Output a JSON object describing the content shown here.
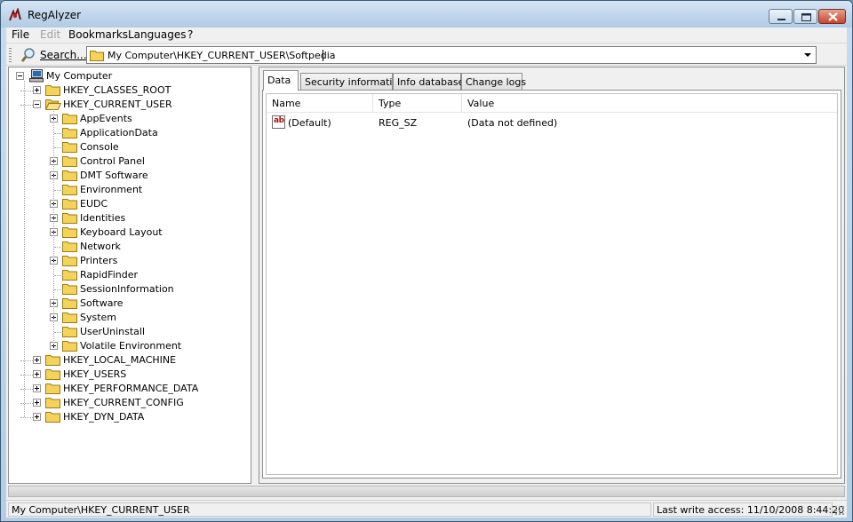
{
  "window": {
    "title": "RegAlyzer"
  },
  "menu": [
    "File",
    "Edit",
    "Bookmarks",
    "Languages",
    "?"
  ],
  "toolbar": {
    "search_label": "Search...",
    "address": "My Computer\\HKEY_CURRENT_USER\\Softpedia"
  },
  "tree": {
    "root": "My Computer",
    "hives": [
      {
        "label": "HKEY_CLASSES_ROOT",
        "expanded": false
      },
      {
        "label": "HKEY_CURRENT_USER",
        "expanded": true,
        "children": [
          {
            "label": "AppEvents",
            "has_children": true
          },
          {
            "label": "ApplicationData",
            "has_children": false
          },
          {
            "label": "Console",
            "has_children": false
          },
          {
            "label": "Control Panel",
            "has_children": true
          },
          {
            "label": "DMT Software",
            "has_children": true
          },
          {
            "label": "Environment",
            "has_children": false
          },
          {
            "label": "EUDC",
            "has_children": true
          },
          {
            "label": "Identities",
            "has_children": true
          },
          {
            "label": "Keyboard Layout",
            "has_children": true
          },
          {
            "label": "Network",
            "has_children": false
          },
          {
            "label": "Printers",
            "has_children": true
          },
          {
            "label": "RapidFinder",
            "has_children": false
          },
          {
            "label": "SessionInformation",
            "has_children": false
          },
          {
            "label": "Software",
            "has_children": true
          },
          {
            "label": "System",
            "has_children": true
          },
          {
            "label": "UserUninstall",
            "has_children": false
          },
          {
            "label": "Volatile Environment",
            "has_children": true
          }
        ]
      },
      {
        "label": "HKEY_LOCAL_MACHINE",
        "expanded": false
      },
      {
        "label": "HKEY_USERS",
        "expanded": false
      },
      {
        "label": "HKEY_PERFORMANCE_DATA",
        "expanded": false
      },
      {
        "label": "HKEY_CURRENT_CONFIG",
        "expanded": false
      },
      {
        "label": "HKEY_DYN_DATA",
        "expanded": false
      }
    ]
  },
  "tabs": [
    "Data",
    "Security information",
    "Info database",
    "Change logs"
  ],
  "active_tab": "Data",
  "values_table": {
    "columns": [
      "Name",
      "Type",
      "Value"
    ],
    "rows": [
      {
        "icon": "string-value-icon",
        "icon_text": "ab",
        "name": "(Default)",
        "type": "REG_SZ",
        "value": "(Data not defined)"
      }
    ]
  },
  "status": {
    "path": "My Computer\\HKEY_CURRENT_USER",
    "last_write": "Last write access: 11/10/2008 8:44:20"
  },
  "icons": {
    "app": "regalyzer-app-icon",
    "search": "magnifier-icon",
    "folder": "folder-icon",
    "computer": "computer-icon",
    "dropdown": "chevron-down-icon"
  },
  "colors": {
    "folder": "#f5d35a",
    "folder_outline": "#9b7b15",
    "title_gradient_top": "#d7e6f4",
    "close_button": "#c8452e"
  }
}
